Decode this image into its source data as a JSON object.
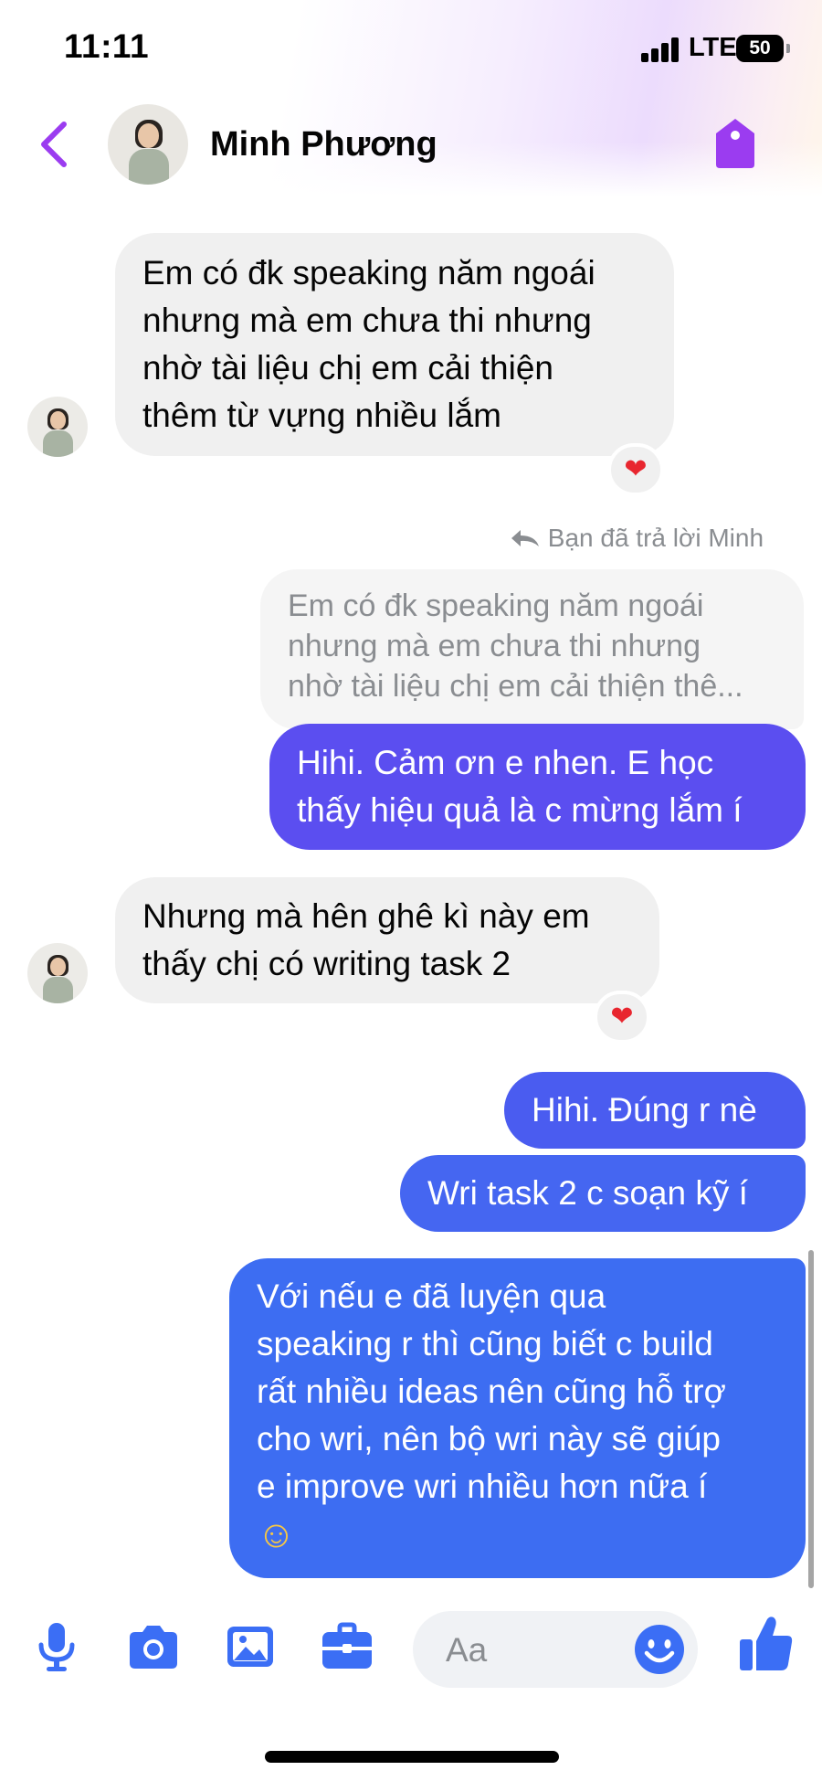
{
  "status_bar": {
    "time": "11:11",
    "network": "LTE",
    "battery": "50"
  },
  "header": {
    "contact_name": "Minh Phương"
  },
  "messages": {
    "m1": {
      "lines": [
        "Em có đk speaking năm ngoái",
        "nhưng mà em chưa thi nhưng",
        "nhờ tài liệu chị em cải thiện",
        "thêm từ vựng nhiều lắm"
      ],
      "reaction": "❤"
    },
    "reply_note": "Bạn đã trả lời Minh",
    "quoted": {
      "lines": [
        "Em có đk speaking năm ngoái",
        "nhưng mà em chưa thi nhưng",
        "nhờ tài liệu chị em cải thiện thê..."
      ]
    },
    "m2": {
      "lines": [
        "Hihi. Cảm ơn e nhen. E học",
        "thấy hiệu quả là c mừng lắm í"
      ]
    },
    "m3": {
      "lines": [
        "Nhưng mà hên ghê kì này em",
        "thấy chị có writing task 2"
      ],
      "reaction": "❤"
    },
    "m4": {
      "text": "Hihi. Đúng r nè"
    },
    "m5": {
      "text": "Wri task 2 c soạn kỹ í"
    },
    "m6": {
      "lines": [
        "Với nếu e đã luyện qua",
        "speaking r thì cũng biết c build",
        "rất nhiều ideas nên cũng hỗ trợ",
        "cho wri, nên bộ wri này sẽ giúp",
        "e improve wri nhiều hơn nữa í",
        "☺"
      ]
    }
  },
  "composer": {
    "placeholder": "Aa"
  },
  "colors": {
    "accent_purple": "#9b3cf0",
    "bubble_purple": "#5b4ef0",
    "bubble_blue": "#3d6df2",
    "incoming_bg": "#f0f0f0",
    "icon_blue": "#3b6ef5"
  },
  "icons": [
    "back-chevron-icon",
    "tag-icon",
    "microphone-icon",
    "camera-icon",
    "image-icon",
    "briefcase-icon",
    "emoji-icon",
    "thumbs-up-icon",
    "reply-arrow-icon",
    "heart-icon"
  ]
}
